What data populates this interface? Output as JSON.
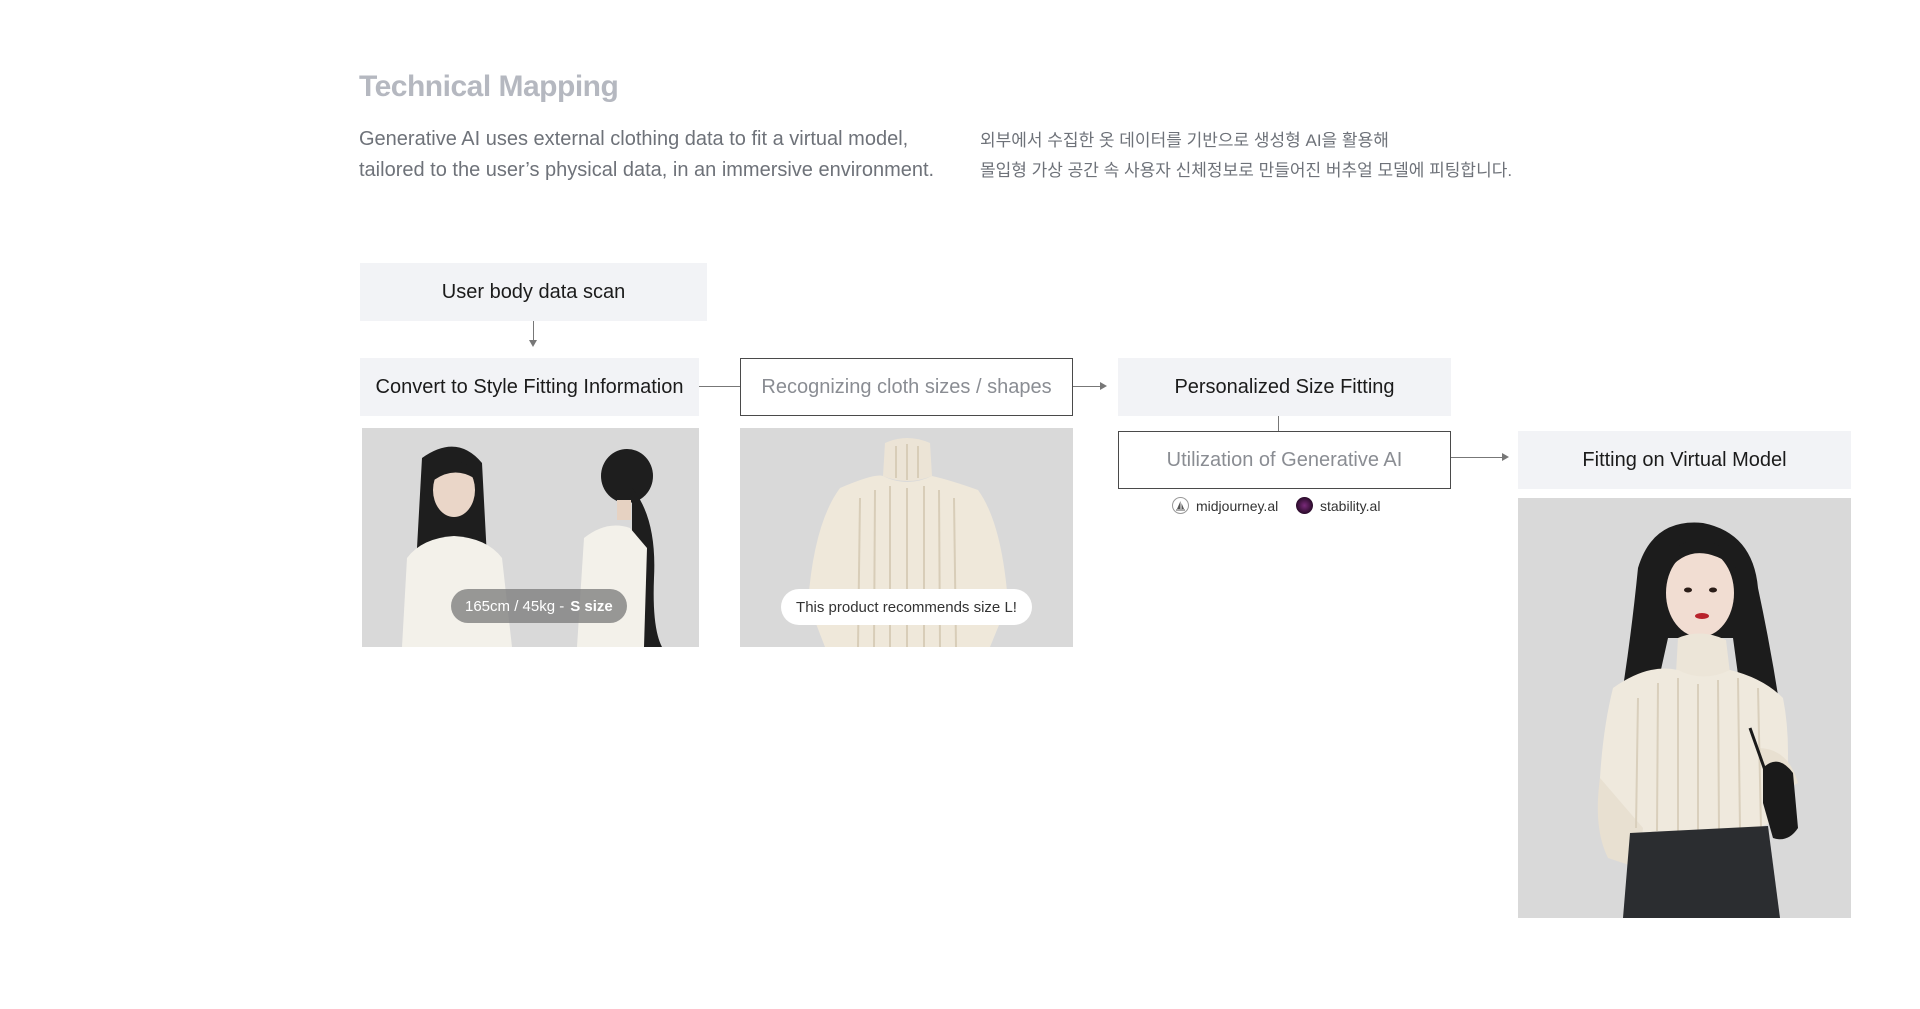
{
  "header": {
    "title": "Technical Mapping",
    "desc_en_line1": "Generative AI uses external clothing data to fit a virtual model,",
    "desc_en_line2": "tailored to the user’s physical data, in an immersive environment.",
    "desc_ko_line1": "외부에서 수집한 옷 데이터를 기반으로 생성형 AI을 활용해",
    "desc_ko_line2": "몰입형 가상 공간 속 사용자 신체정보로 만들어진 버추얼 모델에 피팅합니다."
  },
  "flow": {
    "scan": "User body data scan",
    "convert": "Convert to Style Fitting Information",
    "recognize": "Recognizing cloth sizes / shapes",
    "personalized": "Personalized Size Fitting",
    "generative": "Utilization of Generative AI",
    "virtual": "Fitting on Virtual Model"
  },
  "photos": {
    "body_pill_measure": "165cm / 45kg  -",
    "body_pill_size": "S size",
    "cloth_pill": "This product recommends size L!"
  },
  "brands": [
    {
      "name": "midjourney.al",
      "icon": "sailboat-icon"
    },
    {
      "name": "stability.al",
      "icon": "stability-icon"
    }
  ],
  "colors": {
    "box_fill": "#f2f3f6",
    "photo_bg": "#d9d9d9",
    "title": "#b5b8c0"
  }
}
